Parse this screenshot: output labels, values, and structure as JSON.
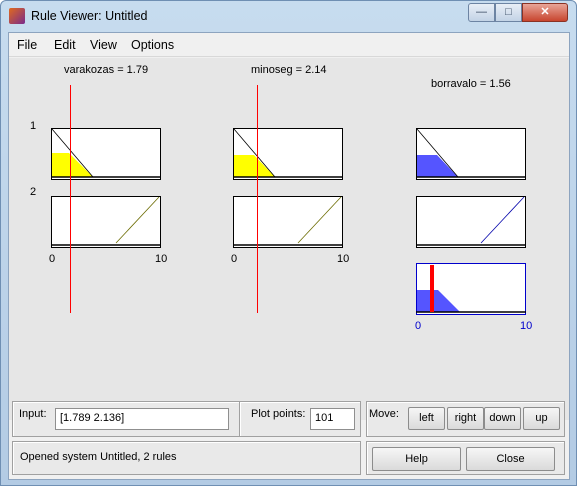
{
  "window": {
    "title": "Rule Viewer: Untitled",
    "min_glyph": "—",
    "max_glyph": "□",
    "close_glyph": "✕"
  },
  "menu": [
    "File",
    "Edit",
    "View",
    "Options"
  ],
  "inputs": [
    {
      "label": "varakozas = 1.79",
      "value": 1.789
    },
    {
      "label": "minoseg = 2.14",
      "value": 2.136
    }
  ],
  "output": {
    "label": "borravalo = 1.56",
    "value": 1.56
  },
  "rules": [
    "1",
    "2"
  ],
  "axis_ticks": {
    "min": "0",
    "max": "10"
  },
  "colors": {
    "input_fill": "#ffff00",
    "output_fill": "#5555ff",
    "marker": "#ff0000",
    "accent_axis": "#0000cc"
  },
  "controls": {
    "input_label": "Input:",
    "input_value": "[1.789 2.136]",
    "plot_points_label": "Plot points:",
    "plot_points_value": "101",
    "move_label": "Move:",
    "move_buttons": [
      "left",
      "right",
      "down",
      "up"
    ],
    "status": "Opened system Untitled, 2 rules",
    "help": "Help",
    "close": "Close"
  }
}
